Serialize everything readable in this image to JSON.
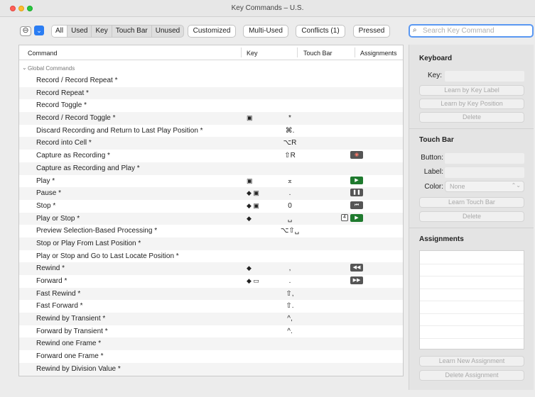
{
  "window": {
    "title": "Key Commands – U.S."
  },
  "toolbar": {
    "expand_symbol": "⊖",
    "menu_symbol": "⌄",
    "filters": [
      {
        "label": "All",
        "selected": true
      },
      {
        "label": "Used",
        "selected": false
      },
      {
        "label": "Key",
        "selected": false
      },
      {
        "label": "Touch Bar",
        "selected": false
      },
      {
        "label": "Unused",
        "selected": false
      }
    ],
    "customized_label": "Customized",
    "multi_used_label": "Multi-Used",
    "conflicts_label": "Conflicts (1)",
    "pressed_label": "Pressed",
    "search_placeholder": "Search Key Command",
    "search_value": ""
  },
  "table": {
    "columns": {
      "command": "Command",
      "key": "Key",
      "touch_bar": "Touch Bar",
      "assignments": "Assignments"
    },
    "group_label": "Global Commands",
    "rows": [
      {
        "command": "Record / Record Repeat *",
        "mod": "",
        "key": "",
        "tb": ""
      },
      {
        "command": "Record Repeat *",
        "mod": "",
        "key": "",
        "tb": ""
      },
      {
        "command": "Record Toggle *",
        "mod": "",
        "key": "",
        "tb": ""
      },
      {
        "command": "Record / Record Toggle *",
        "mod": "▣",
        "key": "*",
        "tb": ""
      },
      {
        "command": "Discard Recording and Return to Last Play Position *",
        "mod": "",
        "key": "⌘.",
        "tb": ""
      },
      {
        "command": "Record into Cell *",
        "mod": "",
        "key": "⌥R",
        "tb": ""
      },
      {
        "command": "Capture as Recording *",
        "mod": "",
        "key": "⇧R",
        "tb": "◉"
      },
      {
        "command": "Capture as Recording and Play *",
        "mod": "",
        "key": "",
        "tb": ""
      },
      {
        "command": "Play *",
        "mod": "▣",
        "key": "⌅",
        "tb": "▶"
      },
      {
        "command": "Pause *",
        "mod": "◆ ▣",
        "key": ".",
        "tb": "❚❚"
      },
      {
        "command": "Stop *",
        "mod": "◆ ▣",
        "key": "0",
        "tb": "⏮"
      },
      {
        "command": "Play or Stop *",
        "mod": "◆",
        "key": "␣",
        "tb": "▶",
        "tb_num": "4"
      },
      {
        "command": "Preview Selection-Based Processing *",
        "mod": "",
        "key": "⌥⇧␣",
        "tb": ""
      },
      {
        "command": "Stop or Play From Last Position *",
        "mod": "",
        "key": "",
        "tb": ""
      },
      {
        "command": "Play or Stop and Go to Last Locate Position *",
        "mod": "",
        "key": "",
        "tb": ""
      },
      {
        "command": "Rewind *",
        "mod": "◆",
        "key": ",",
        "tb": "◀◀"
      },
      {
        "command": "Forward *",
        "mod": "◆ ▭",
        "key": ".",
        "tb": "▶▶"
      },
      {
        "command": "Fast Rewind *",
        "mod": "",
        "key": "⇧,",
        "tb": ""
      },
      {
        "command": "Fast Forward *",
        "mod": "",
        "key": "⇧.",
        "tb": ""
      },
      {
        "command": "Rewind by Transient *",
        "mod": "",
        "key": "^,",
        "tb": ""
      },
      {
        "command": "Forward by Transient *",
        "mod": "",
        "key": "^.",
        "tb": ""
      },
      {
        "command": "Rewind one Frame *",
        "mod": "",
        "key": "",
        "tb": ""
      },
      {
        "command": "Forward one Frame *",
        "mod": "",
        "key": "",
        "tb": ""
      },
      {
        "command": "Rewind by Division Value *",
        "mod": "",
        "key": "",
        "tb": ""
      }
    ]
  },
  "panel": {
    "keyboard_heading": "Keyboard",
    "key_label": "Key:",
    "learn_by_key_label": "Learn by Key Label",
    "learn_by_key_position": "Learn by Key Position",
    "delete_label": "Delete",
    "touch_bar_heading": "Touch Bar",
    "button_label": "Button:",
    "label_label": "Label:",
    "color_label": "Color:",
    "color_value": "None",
    "learn_touch_bar": "Learn Touch Bar",
    "delete_tb_label": "Delete",
    "assignments_heading": "Assignments",
    "learn_new_assignment": "Learn New Assignment",
    "delete_assignment": "Delete Assignment"
  },
  "colors": {
    "accent": "#2b7df3",
    "touch_bar_green": "#1f7a2e",
    "touch_bar_gray": "#555555"
  }
}
